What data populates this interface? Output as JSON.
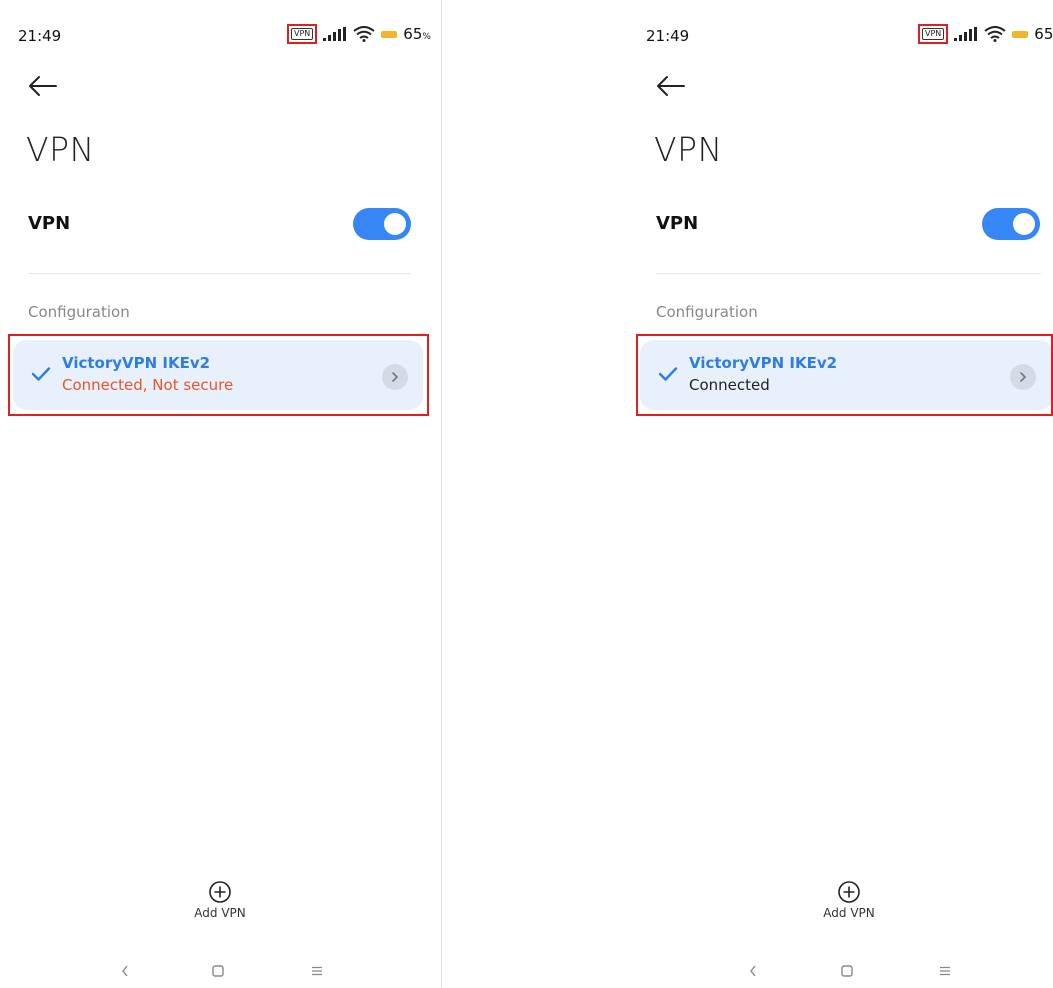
{
  "screens": [
    {
      "status_bar": {
        "time": "21:49",
        "vpn_badge": "VPN",
        "battery_level": "65",
        "battery_unit": "%",
        "icons": [
          "vpn-badge-icon",
          "signal-icon",
          "wifi-icon",
          "battery-icon"
        ]
      },
      "title": "VPN",
      "vpn_toggle": {
        "label": "VPN",
        "on": true
      },
      "section_header": "Configuration",
      "config_item": {
        "name": "VictoryVPN IKEv2",
        "status": "Connected, Not secure",
        "status_color": "#e8552b",
        "selected": true
      },
      "add_button_label": "Add VPN"
    },
    {
      "status_bar": {
        "time": "21:49",
        "vpn_badge": "VPN",
        "battery_level": "65",
        "battery_unit": "%",
        "icons": [
          "vpn-badge-icon",
          "signal-icon",
          "wifi-icon",
          "battery-icon"
        ]
      },
      "title": "VPN",
      "vpn_toggle": {
        "label": "VPN",
        "on": true
      },
      "section_header": "Configuration",
      "config_item": {
        "name": "VictoryVPN IKEv2",
        "status": "Connected",
        "status_color": "#222222",
        "selected": true
      },
      "add_button_label": "Add VPN"
    }
  ],
  "colors": {
    "accent": "#3686f5",
    "card_background": "#e8f0fc",
    "highlight_border": "#e02020",
    "battery": "#f2b52a"
  },
  "nav_icons": [
    "nav-back-icon",
    "nav-home-icon",
    "nav-menu-icon"
  ]
}
